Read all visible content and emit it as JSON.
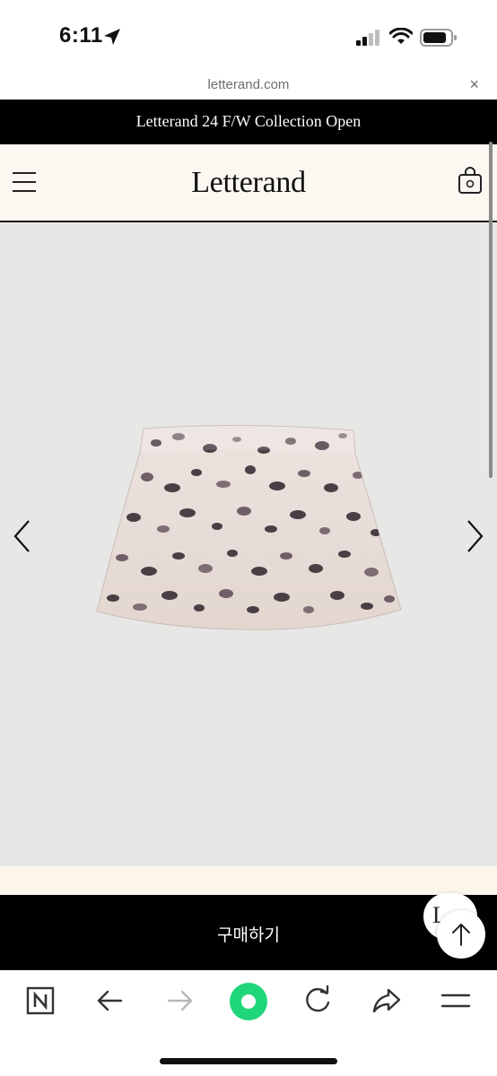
{
  "status_bar": {
    "time": "6:11",
    "icons": [
      "location-arrow-icon",
      "cellular-signal-icon",
      "wifi-icon",
      "battery-icon"
    ]
  },
  "browser": {
    "url": "letterand.com",
    "close_symbol": "×"
  },
  "announcement": {
    "text": "Letterand 24 F/W Collection Open"
  },
  "header": {
    "brand": "Letterand",
    "menu_icon": "hamburger-menu-icon",
    "cart_icon": "shopping-bag-icon"
  },
  "product": {
    "image": "leopard-print-mini-skirt",
    "prev_icon": "chevron-left-icon",
    "next_icon": "chevron-right-icon"
  },
  "purchase": {
    "buy_label": "구매하기",
    "badge_text": "L",
    "scroll_top_icon": "arrow-up-icon"
  },
  "toolbar": {
    "items": [
      "naver-n-icon",
      "back-arrow-icon",
      "forward-arrow-icon",
      "green-circle-icon",
      "refresh-icon",
      "share-icon",
      "menu-lines-icon"
    ]
  },
  "colors": {
    "black": "#000000",
    "header_bg": "#fcf8f1",
    "product_bg": "#e7e7e5",
    "green": "#1fd67a"
  }
}
